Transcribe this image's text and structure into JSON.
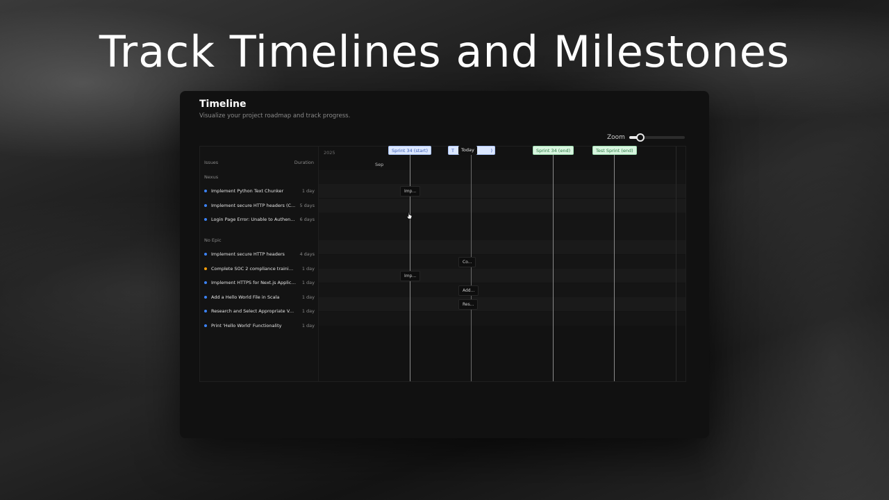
{
  "hero": {
    "title": "Track Timelines and Milestones"
  },
  "panel": {
    "title": "Timeline",
    "subtitle": "Visualize your project roadmap and track progress.",
    "zoom_label": "Zoom",
    "zoom_level": 0.15
  },
  "grid": {
    "header": {
      "issues": "Issues",
      "duration": "Duration",
      "year": "2025",
      "month": "Sep"
    },
    "groups": [
      {
        "name": "Nexus",
        "issues": [
          {
            "name": "Implement Python Text Chunker",
            "duration": "1 day",
            "dot_color": "#3b82f6"
          },
          {
            "name": "Implement secure HTTP headers (C...",
            "duration": "5 days",
            "dot_color": "#3b82f6"
          },
          {
            "name": "Login Page Error: Unable to Authen...",
            "duration": "6 days",
            "dot_color": "#3b82f6"
          }
        ]
      },
      {
        "name": "No Epic",
        "issues": [
          {
            "name": "Implement secure HTTP headers",
            "duration": "4 days",
            "dot_color": "#3b82f6"
          },
          {
            "name": "Complete SOC 2 compliance training.",
            "duration": "1 day",
            "dot_color": "#f59e0b"
          },
          {
            "name": "Implement HTTPS for Next.js Applica...",
            "duration": "1 day",
            "dot_color": "#3b82f6"
          },
          {
            "name": "Add a Hello World File in Scala",
            "duration": "1 day",
            "dot_color": "#3b82f6"
          },
          {
            "name": "Research and Select Appropriate Ve...",
            "duration": "1 day",
            "dot_color": "#3b82f6"
          },
          {
            "name": "Print 'Hello World' Functionality",
            "duration": "1 day",
            "dot_color": "#3b82f6"
          }
        ]
      }
    ],
    "markers": {
      "sprint34_start": "Sprint 34 (start)",
      "hidden": "T",
      "hidden_end": ")",
      "today": "Today",
      "sprint34_end": "Sprint 34 (end)",
      "test_sprint_end": "Test Sprint (end)"
    },
    "bars": {
      "b1": "Imp...",
      "b2": "Co...",
      "b3": "Imp...",
      "b4": "Add...",
      "b5": "Res..."
    }
  }
}
